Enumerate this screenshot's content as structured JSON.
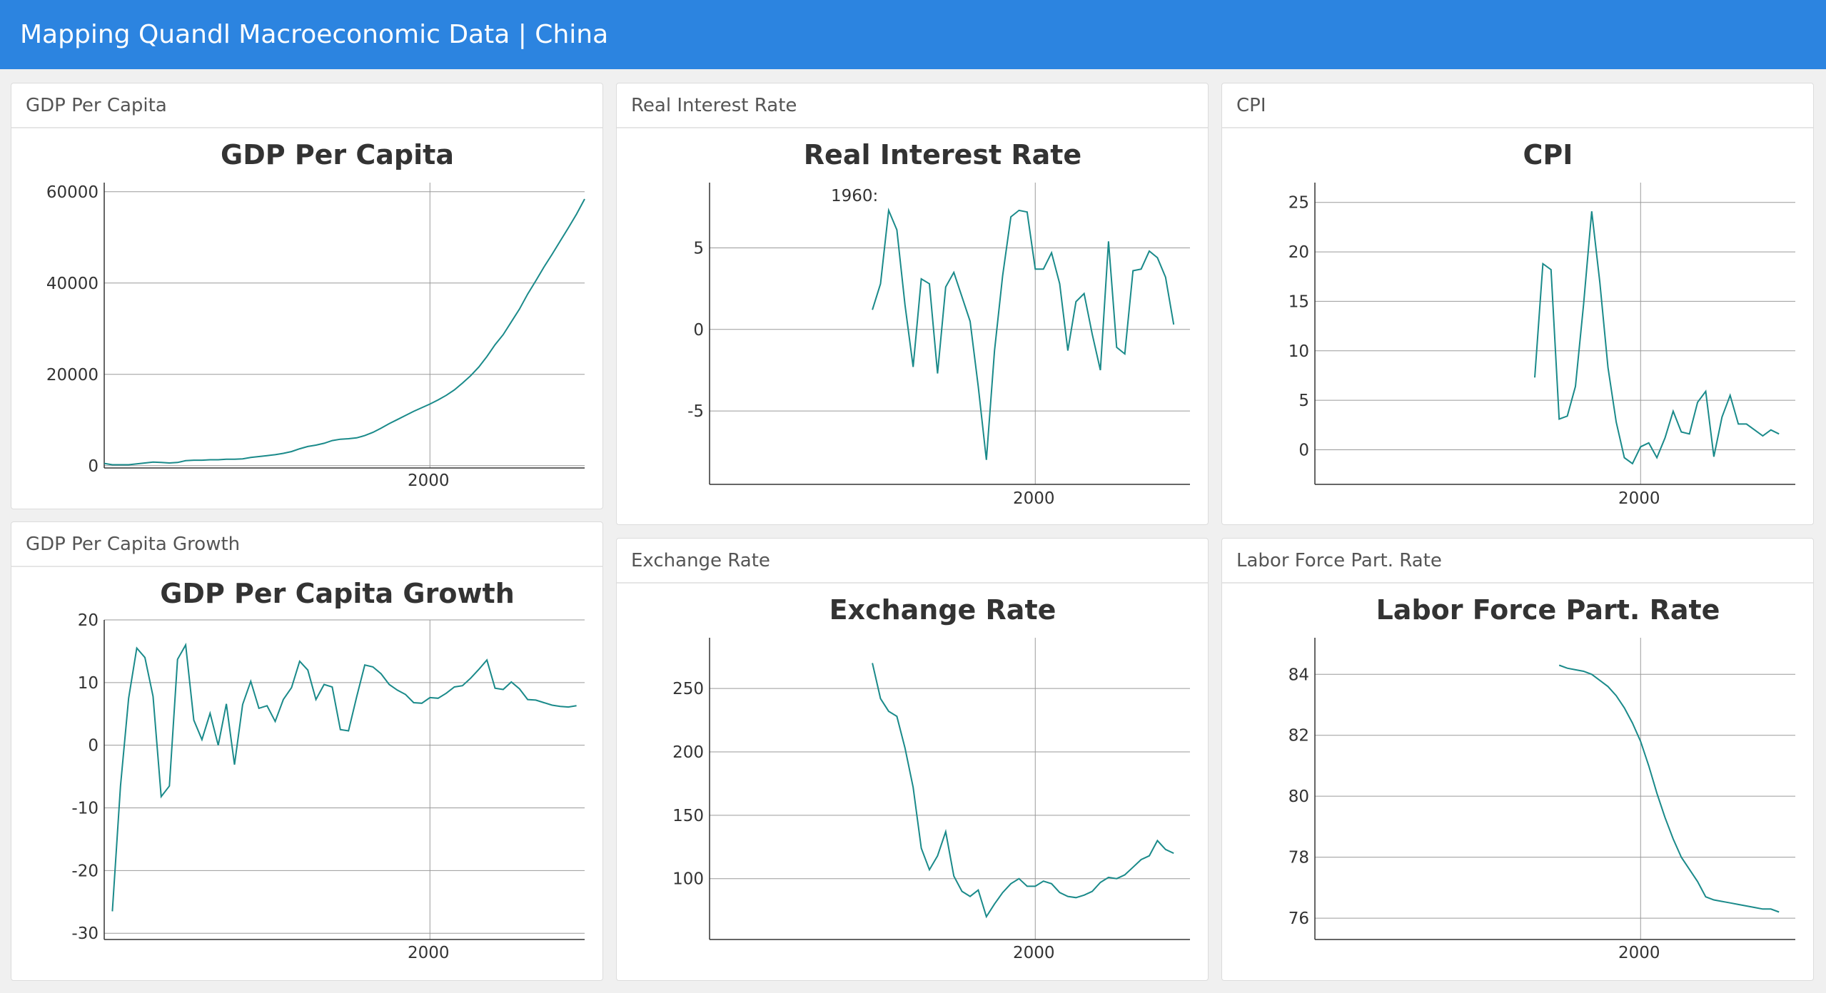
{
  "header": {
    "title": "Mapping Quandl Macroeconomic Data | China"
  },
  "colors": {
    "topbar": "#2c84e0",
    "line": "#1a8a8a",
    "grid": "#9a9a9a",
    "axis": "#333333"
  },
  "panels": [
    {
      "id": "gdp-per-capita",
      "header_label": "GDP Per Capita",
      "chart_data": {
        "type": "line",
        "title": "GDP Per Capita",
        "xlabel": "",
        "ylabel": "",
        "xlim": [
          1960,
          2019
        ],
        "ylim": [
          -500,
          62000
        ],
        "x_ticks": [
          2000
        ],
        "y_ticks": [
          0,
          20000,
          40000,
          60000
        ],
        "y_tick_labels": [
          "0",
          "20000",
          "40000",
          "60000"
        ],
        "grid": true,
        "series": [
          {
            "x": [
              1960,
              1961,
              1962,
              1963,
              1964,
              1965,
              1966,
              1967,
              1968,
              1969,
              1970,
              1971,
              1972,
              1973,
              1974,
              1975,
              1976,
              1977,
              1978,
              1979,
              1980,
              1981,
              1982,
              1983,
              1984,
              1985,
              1986,
              1987,
              1988,
              1989,
              1990,
              1991,
              1992,
              1993,
              1994,
              1995,
              1996,
              1997,
              1998,
              1999,
              2000,
              2001,
              2002,
              2003,
              2004,
              2005,
              2006,
              2007,
              2008,
              2009,
              2010,
              2011,
              2012,
              2013,
              2014,
              2015,
              2016,
              2017,
              2018,
              2019
            ],
            "y": [
              500,
              200,
              200,
              200,
              400,
              600,
              800,
              700,
              600,
              700,
              1100,
              1200,
              1200,
              1300,
              1300,
              1400,
              1400,
              1500,
              1800,
              2000,
              2200,
              2400,
              2700,
              3100,
              3700,
              4200,
              4500,
              4900,
              5500,
              5800,
              5900,
              6100,
              6600,
              7300,
              8200,
              9200,
              10100,
              11000,
              11900,
              12700,
              13500,
              14400,
              15400,
              16600,
              18100,
              19700,
              21600,
              23900,
              26500,
              28700,
              31500,
              34300,
              37600,
              40500,
              43500,
              46300,
              49200,
              52100,
              55100,
              58400
            ]
          }
        ]
      }
    },
    {
      "id": "gdp-per-capita-growth",
      "header_label": "GDP Per Capita Growth",
      "chart_data": {
        "type": "line",
        "title": "GDP Per Capita Growth",
        "xlabel": "",
        "ylabel": "",
        "xlim": [
          1960,
          2019
        ],
        "ylim": [
          -31,
          20
        ],
        "x_ticks": [
          2000
        ],
        "y_ticks": [
          -30,
          -20,
          -10,
          0,
          10,
          20
        ],
        "y_tick_labels": [
          "-30",
          "-20",
          "-10",
          "0",
          "10",
          "20"
        ],
        "grid": true,
        "series": [
          {
            "x": [
              1961,
              1962,
              1963,
              1964,
              1965,
              1966,
              1967,
              1968,
              1969,
              1970,
              1971,
              1972,
              1973,
              1974,
              1975,
              1976,
              1977,
              1978,
              1979,
              1980,
              1981,
              1982,
              1983,
              1984,
              1985,
              1986,
              1987,
              1988,
              1989,
              1990,
              1991,
              1992,
              1993,
              1994,
              1995,
              1996,
              1997,
              1998,
              1999,
              2000,
              2001,
              2002,
              2003,
              2004,
              2005,
              2006,
              2007,
              2008,
              2009,
              2010,
              2011,
              2012,
              2013,
              2014,
              2015,
              2016,
              2017,
              2018,
              2019
            ],
            "y": [
              -26.5,
              -6.5,
              7.5,
              15.5,
              14,
              7.8,
              -8.2,
              -6.5,
              13.7,
              16,
              4,
              0.9,
              5.1,
              0,
              6.6,
              -3.1,
              6.5,
              10.2,
              5.9,
              6.3,
              3.8,
              7.3,
              9.2,
              13.4,
              12,
              7.3,
              9.7,
              9.3,
              2.5,
              2.3,
              7.7,
              12.8,
              12.5,
              11.4,
              9.7,
              8.8,
              8.1,
              6.8,
              6.7,
              7.6,
              7.5,
              8.3,
              9.3,
              9.5,
              10.7,
              12.1,
              13.6,
              9.1,
              8.9,
              10.1,
              9,
              7.3,
              7.2,
              6.8,
              6.4,
              6.2,
              6.1,
              6.3
            ]
          }
        ]
      }
    },
    {
      "id": "real-interest-rate",
      "header_label": "Real Interest Rate",
      "chart_data": {
        "type": "line",
        "title": "Real Interest Rate",
        "annotation": "1960:",
        "xlabel": "",
        "ylabel": "",
        "xlim": [
          1960,
          2019
        ],
        "ylim": [
          -9.5,
          9
        ],
        "x_ticks": [
          2000
        ],
        "y_ticks": [
          -5,
          0,
          5
        ],
        "y_tick_labels": [
          "-5",
          "0",
          "5"
        ],
        "grid": true,
        "series": [
          {
            "x": [
              1980,
              1981,
              1982,
              1983,
              1984,
              1985,
              1986,
              1987,
              1988,
              1989,
              1990,
              1991,
              1992,
              1993,
              1994,
              1995,
              1996,
              1997,
              1998,
              1999,
              2000,
              2001,
              2002,
              2003,
              2004,
              2005,
              2006,
              2007,
              2008,
              2009,
              2010,
              2011,
              2012,
              2013,
              2014,
              2015,
              2016,
              2017,
              2018,
              2019
            ],
            "y": [
              1.2,
              2.8,
              7.3,
              6.1,
              1.5,
              -2.3,
              3.1,
              2.8,
              -2.7,
              2.6,
              3.5,
              2,
              0.5,
              -3.5,
              -8,
              -1.3,
              3.3,
              6.9,
              7.3,
              7.2,
              3.7,
              3.7,
              4.7,
              2.8,
              -1.3,
              1.7,
              2.2,
              -0.3,
              -2.5,
              5.4,
              -1.1,
              -1.5,
              3.6,
              3.7,
              4.8,
              4.4,
              3.2,
              0.3
            ]
          }
        ]
      }
    },
    {
      "id": "exchange-rate",
      "header_label": "Exchange Rate",
      "chart_data": {
        "type": "line",
        "title": "Exchange Rate",
        "xlabel": "",
        "ylabel": "",
        "xlim": [
          1960,
          2019
        ],
        "ylim": [
          52,
          290
        ],
        "x_ticks": [
          2000
        ],
        "y_ticks": [
          100,
          150,
          200,
          250
        ],
        "y_tick_labels": [
          "100",
          "150",
          "200",
          "250"
        ],
        "grid": true,
        "series": [
          {
            "x": [
              1980,
              1981,
              1982,
              1983,
              1984,
              1985,
              1986,
              1987,
              1988,
              1989,
              1990,
              1991,
              1992,
              1993,
              1994,
              1995,
              1996,
              1997,
              1998,
              1999,
              2000,
              2001,
              2002,
              2003,
              2004,
              2005,
              2006,
              2007,
              2008,
              2009,
              2010,
              2011,
              2012,
              2013,
              2014,
              2015,
              2016,
              2017,
              2018,
              2019
            ],
            "y": [
              270,
              242,
              232,
              228,
              203,
              172,
              124,
              107,
              118,
              137,
              102,
              90,
              86,
              91,
              70,
              80,
              89,
              96,
              100,
              94,
              94,
              98,
              96,
              89,
              86,
              85,
              87,
              90,
              97,
              101,
              100,
              103,
              109,
              115,
              118,
              130,
              123,
              120
            ]
          }
        ]
      }
    },
    {
      "id": "cpi",
      "header_label": "CPI",
      "chart_data": {
        "type": "line",
        "title": "CPI",
        "xlabel": "",
        "ylabel": "",
        "xlim": [
          1960,
          2019
        ],
        "ylim": [
          -3.5,
          27
        ],
        "x_ticks": [
          2000
        ],
        "y_ticks": [
          0,
          5,
          10,
          15,
          20,
          25
        ],
        "y_tick_labels": [
          "0",
          "5",
          "10",
          "15",
          "20",
          "25"
        ],
        "grid": true,
        "series": [
          {
            "x": [
              1987,
              1988,
              1989,
              1990,
              1991,
              1992,
              1993,
              1994,
              1995,
              1996,
              1997,
              1998,
              1999,
              2000,
              2001,
              2002,
              2003,
              2004,
              2005,
              2006,
              2007,
              2008,
              2009,
              2010,
              2011,
              2012,
              2013,
              2014,
              2015,
              2016,
              2017,
              2018,
              2019
            ],
            "y": [
              7.3,
              18.8,
              18.2,
              3.1,
              3.4,
              6.4,
              14.7,
              24.1,
              16.9,
              8.3,
              2.8,
              -0.8,
              -1.4,
              0.3,
              0.7,
              -0.8,
              1.2,
              3.9,
              1.8,
              1.6,
              4.8,
              5.9,
              -0.7,
              3.3,
              5.5,
              2.6,
              2.6,
              2,
              1.4,
              2,
              1.6
            ]
          }
        ]
      }
    },
    {
      "id": "labor-force-part-rate",
      "header_label": "Labor Force Part. Rate",
      "chart_data": {
        "type": "line",
        "title": "Labor Force Part. Rate",
        "xlabel": "",
        "ylabel": "",
        "xlim": [
          1960,
          2019
        ],
        "ylim": [
          75.3,
          85.2
        ],
        "x_ticks": [
          2000
        ],
        "y_ticks": [
          76,
          78,
          80,
          82,
          84
        ],
        "y_tick_labels": [
          "76",
          "78",
          "80",
          "82",
          "84"
        ],
        "grid": true,
        "series": [
          {
            "x": [
              1990,
              1991,
              1992,
              1993,
              1994,
              1995,
              1996,
              1997,
              1998,
              1999,
              2000,
              2001,
              2002,
              2003,
              2004,
              2005,
              2006,
              2007,
              2008,
              2009,
              2010,
              2011,
              2012,
              2013,
              2014,
              2015,
              2016,
              2017,
              2018,
              2019
            ],
            "y": [
              84.3,
              84.2,
              84.15,
              84.1,
              84,
              83.8,
              83.6,
              83.3,
              82.9,
              82.4,
              81.8,
              81,
              80.1,
              79.3,
              78.6,
              78,
              77.6,
              77.2,
              76.7,
              76.6,
              76.55,
              76.5,
              76.45,
              76.4,
              76.35,
              76.3,
              76.3,
              76.2
            ]
          }
        ]
      }
    }
  ]
}
